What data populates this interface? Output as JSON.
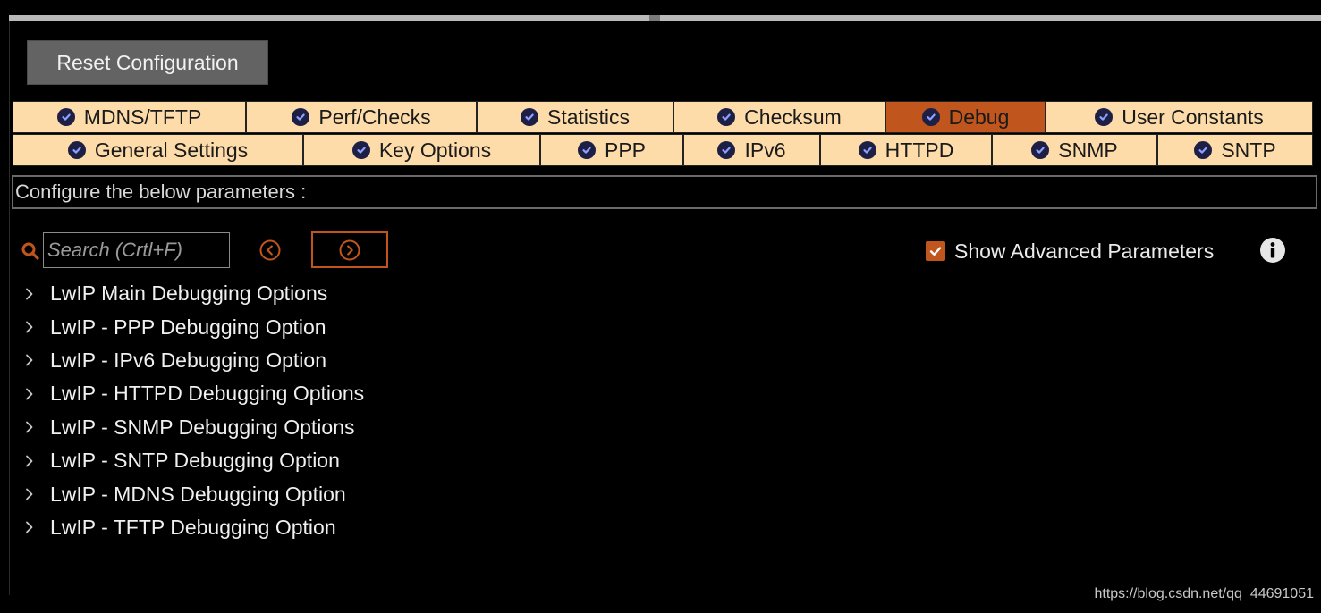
{
  "toolbar": {
    "reset_label": "Reset Configuration"
  },
  "tabs_row1": [
    {
      "label": "MDNS/TFTP",
      "active": false
    },
    {
      "label": "Perf/Checks",
      "active": false
    },
    {
      "label": "Statistics",
      "active": false
    },
    {
      "label": "Checksum",
      "active": false
    },
    {
      "label": "Debug",
      "active": true
    },
    {
      "label": "User Constants",
      "active": false
    }
  ],
  "tabs_row2": [
    {
      "label": "General Settings"
    },
    {
      "label": "Key Options"
    },
    {
      "label": "PPP"
    },
    {
      "label": "IPv6"
    },
    {
      "label": "HTTPD"
    },
    {
      "label": "SNMP"
    },
    {
      "label": "SNTP"
    }
  ],
  "configure_text": "Configure the below parameters :",
  "search": {
    "placeholder": "Search (Crtl+F)",
    "value": ""
  },
  "show_advanced": {
    "label": "Show Advanced Parameters",
    "checked": true
  },
  "tree_items": [
    "LwIP Main Debugging Options",
    "LwIP - PPP Debugging Option",
    "LwIP - IPv6 Debugging Option",
    "LwIP - HTTPD Debugging Options",
    "LwIP - SNMP Debugging Options",
    "LwIP - SNTP Debugging Option",
    "LwIP - MDNS Debugging Option",
    "LwIP - TFTP Debugging Option"
  ],
  "watermark": "https://blog.csdn.net/qq_44691051",
  "colors": {
    "accent": "#c0561e",
    "tab_bg": "#fddcaa",
    "check_icon": "#1d1f44",
    "background": "#000000"
  },
  "icons": {
    "tab_status": "check-circle-icon",
    "search": "search-icon",
    "prev": "circle-chevron-left-icon",
    "next": "circle-chevron-right-icon",
    "info": "info-icon",
    "tree_expand": "chevron-right-icon"
  }
}
